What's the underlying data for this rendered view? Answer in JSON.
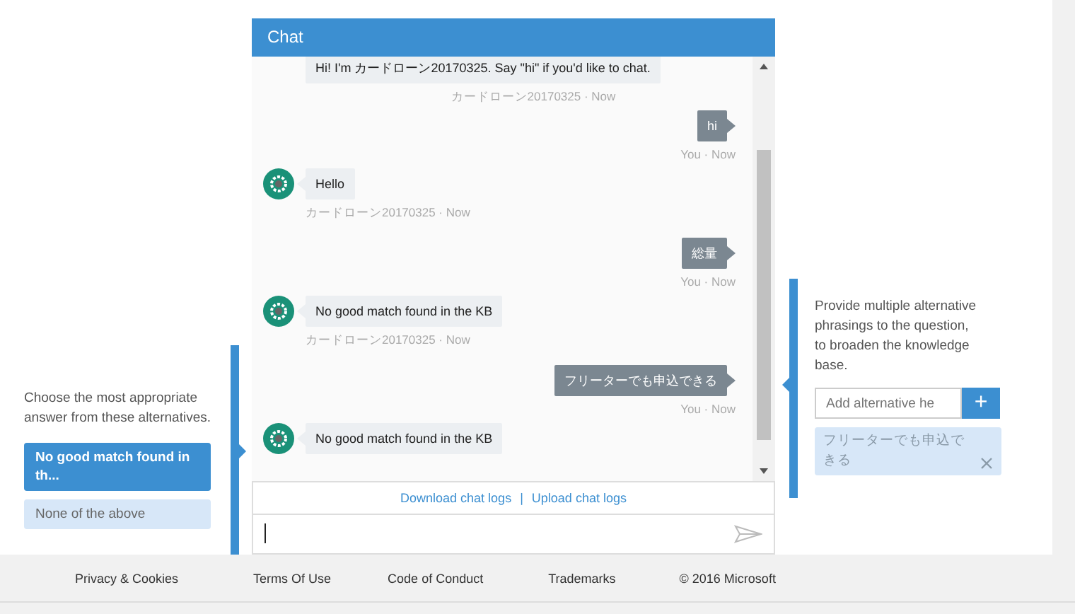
{
  "chat": {
    "title": "Chat",
    "messages": [
      {
        "kind": "bot",
        "avatar": false,
        "text": "Hi! I'm カードローン20170325. Say \"hi\" if you'd like to chat.",
        "meta": "カードローン20170325 · Now"
      },
      {
        "kind": "user",
        "text": "hi",
        "meta": "You · Now"
      },
      {
        "kind": "bot",
        "avatar": true,
        "text": "Hello",
        "meta": "カードローン20170325 · Now"
      },
      {
        "kind": "user",
        "text": "総量",
        "meta": "You · Now"
      },
      {
        "kind": "bot",
        "avatar": true,
        "text": "No good match found in the KB",
        "meta": "カードローン20170325 · Now"
      },
      {
        "kind": "user",
        "text": "フリーターでも申込できる",
        "meta": "You · Now"
      },
      {
        "kind": "bot",
        "avatar": true,
        "text": "No good match found in the KB"
      }
    ],
    "log_links": [
      "Download chat logs",
      "Upload chat logs"
    ],
    "separator": "|"
  },
  "answers_panel": {
    "prompt": "Choose the most appropriate answer from these alternatives.",
    "options": [
      {
        "label": "No good match found in th...",
        "selected": true
      },
      {
        "label": "None of the above",
        "selected": false
      }
    ]
  },
  "alternatives_panel": {
    "prompt": "Provide multiple alternative phrasings to the question, to broaden the knowledge base.",
    "input": {
      "placeholder": "Add alternative he"
    },
    "add_button": "+",
    "alternatives": [
      "フリーターでも申込できる"
    ]
  },
  "footer": [
    "Privacy & Cookies",
    "Terms Of Use",
    "Code of Conduct",
    "Trademarks",
    "© 2016 Microsoft"
  ]
}
